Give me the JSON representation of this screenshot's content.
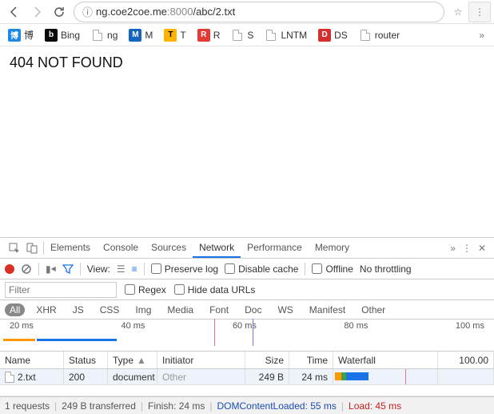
{
  "address": {
    "host": "ng.coe2coe.me",
    "port": ":8000",
    "path": "/abc/2.txt"
  },
  "bookmarks": [
    {
      "label": "博",
      "bg": "#1e88e5",
      "fg": "#fff"
    },
    {
      "label": "Bing",
      "bg": "#0a0a0a",
      "fg": "#fff",
      "ic": "b"
    },
    {
      "label": "ng",
      "bg": "",
      "fg": "",
      "file": true
    },
    {
      "label": "M",
      "bg": "#1565c0",
      "fg": "#fff"
    },
    {
      "label": "T",
      "bg": "#ffb300",
      "fg": "#000"
    },
    {
      "label": "R",
      "bg": "#e53935",
      "fg": "#fff"
    },
    {
      "label": "S",
      "bg": "",
      "fg": "",
      "file": true
    },
    {
      "label": "LNTM",
      "bg": "",
      "fg": "",
      "file": true
    },
    {
      "label": "DS",
      "bg": "#d32f2f",
      "fg": "#fff"
    },
    {
      "label": "router",
      "bg": "",
      "fg": "",
      "file": true
    }
  ],
  "page_body": "404 NOT FOUND",
  "dev_tabs": [
    "Elements",
    "Console",
    "Sources",
    "Network",
    "Performance",
    "Memory"
  ],
  "net_toolbar": {
    "view": "View:",
    "preserve": "Preserve log",
    "disable": "Disable cache",
    "offline": "Offline",
    "throttle": "No throttling"
  },
  "filter": {
    "placeholder": "Filter",
    "regex": "Regex",
    "hide": "Hide data URLs"
  },
  "types": [
    "All",
    "XHR",
    "JS",
    "CSS",
    "Img",
    "Media",
    "Font",
    "Doc",
    "WS",
    "Manifest",
    "Other"
  ],
  "timeline_ticks": [
    "20 ms",
    "40 ms",
    "60 ms",
    "80 ms",
    "100 ms"
  ],
  "headers": {
    "name": "Name",
    "status": "Status",
    "type": "Type",
    "initiator": "Initiator",
    "size": "Size",
    "time": "Time",
    "waterfall": "Waterfall",
    "end": "100.00"
  },
  "row": {
    "name": "2.txt",
    "status": "200",
    "type": "document",
    "initiator": "Other",
    "size": "249 B",
    "time": "24 ms"
  },
  "footer": {
    "requests": "1 requests",
    "transferred": "249 B transferred",
    "finish": "Finish: 24 ms",
    "dcl": "DOMContentLoaded: 55 ms",
    "load": "Load: 45 ms"
  }
}
